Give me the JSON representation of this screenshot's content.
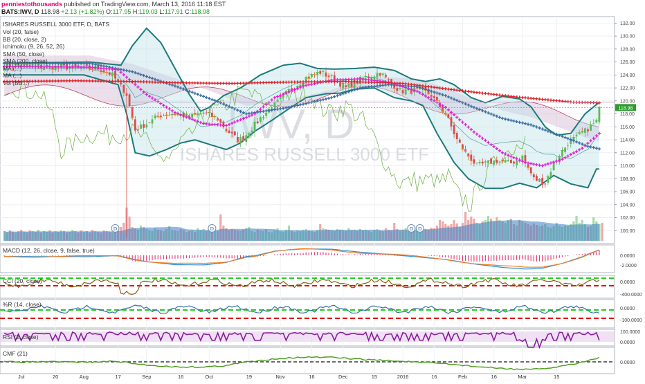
{
  "header": {
    "author": "penniestothousands",
    "published": "published on TradingView.com, March 13, 2016 11:18 EST",
    "symbol": "BATS:IWV, D",
    "last": "118.98",
    "change": "+2.13 (+1.82%)",
    "ohlc_o_label": "O:",
    "ohlc_o": "117.95",
    "ohlc_h_label": "H:",
    "ohlc_h": "119.03",
    "ohlc_l_label": "L:",
    "ohlc_l": "117.91",
    "ohlc_c_label": "C:",
    "ohlc_c": "118.98"
  },
  "main_pane": {
    "title": "ISHARES RUSSELL 3000 ETF, D, BATS",
    "indicators": [
      "Vol (20, false)",
      "BB (20, close, 2)",
      "Ichimoku (9, 26, 52, 26)",
      "SMA (50, close)",
      "SMA (200, close)",
      "MA (...)",
      "MA (...)",
      "Vol (BB...)"
    ],
    "watermark_big": "IWV, D",
    "watermark_small": "ISHARES RUSSELL 3000 ETF",
    "price_badge": "118.98"
  },
  "subpanes": [
    {
      "label": "MACD (12, 26, close, 9, false, true)",
      "ticks": [
        "0.0000",
        "-2.0000"
      ]
    },
    {
      "label": "CCI (20, close)",
      "ticks": [
        "0.0000",
        "-400.0000"
      ]
    },
    {
      "label": "%R (14, close)",
      "ticks": [
        "0.0000",
        "-100.0000"
      ]
    },
    {
      "label": "RSI (2, close)",
      "ticks": [
        "100.0000",
        "0.0000"
      ]
    },
    {
      "label": "CMF (21)",
      "ticks": [
        "0.0000"
      ]
    }
  ],
  "dividend_marker": "D",
  "colors": {
    "up": "#5fb85f",
    "down": "#d94c4c",
    "bb": "#1b7a7a",
    "sma200": "#d9262c",
    "sma50": "#3b6a9e",
    "ma_fast": "#e020d0",
    "ichimoku_cloud": "#c9a2c9",
    "lagging": "#6aad3a",
    "macd": "#2a8fd6",
    "signal": "#ef7d21",
    "hist": "#e0407a",
    "osc": "#2f6f9f",
    "rsi": "#8a1ca0",
    "cmf": "#4a9a1a",
    "level_green": "#22cc22",
    "level_red": "#dd1111"
  },
  "chart_data": {
    "type": "candlestick",
    "title": "ISHARES RUSSELL 3000 ETF, D, BATS",
    "x_tick_labels": [
      "Jul",
      "20",
      "Aug",
      "17",
      "Sep",
      "16",
      "Oct",
      "19",
      "Nov",
      "16",
      "Dec",
      "15",
      "2016",
      "16",
      "Feb",
      "16",
      "Mar",
      "15"
    ],
    "y_tick_labels": [
      "132.00",
      "130.00",
      "128.00",
      "126.00",
      "124.00",
      "122.00",
      "120.00",
      "118.00",
      "116.00",
      "114.00",
      "112.00",
      "110.00",
      "108.00",
      "106.00",
      "104.00",
      "102.00",
      "100.00"
    ],
    "ylim": [
      98,
      133
    ],
    "close_path": [
      [
        0,
        125.5
      ],
      [
        20,
        125.2
      ],
      [
        33,
        125.0
      ],
      [
        38,
        124.0
      ],
      [
        43,
        121.0
      ],
      [
        46,
        115.5
      ],
      [
        50,
        116.5
      ],
      [
        55,
        117.8
      ],
      [
        60,
        118.0
      ],
      [
        65,
        117.5
      ],
      [
        70,
        118.2
      ],
      [
        75,
        117.2
      ],
      [
        78,
        115.5
      ],
      [
        82,
        114.0
      ],
      [
        84,
        114.3
      ],
      [
        89,
        116.8
      ],
      [
        95,
        119.5
      ],
      [
        100,
        121.5
      ],
      [
        106,
        123.5
      ],
      [
        111,
        124.4
      ],
      [
        115,
        123.6
      ],
      [
        120,
        122.0
      ],
      [
        126,
        123.5
      ],
      [
        132,
        124.3
      ],
      [
        134,
        123.5
      ],
      [
        139,
        121.5
      ],
      [
        143,
        121.5
      ],
      [
        147,
        121.7
      ],
      [
        150,
        120.8
      ],
      [
        155,
        118.0
      ],
      [
        159,
        114.0
      ],
      [
        162,
        112.0
      ],
      [
        166,
        110.0
      ],
      [
        173,
        110.8
      ],
      [
        178,
        110.4
      ],
      [
        182,
        111.3
      ],
      [
        186,
        108.0
      ],
      [
        190,
        107.3
      ],
      [
        193,
        110.3
      ],
      [
        198,
        113.5
      ],
      [
        203,
        115.0
      ],
      [
        208,
        116.8
      ],
      [
        209,
        118.98
      ]
    ],
    "bb_upper": [
      [
        0,
        125.8
      ],
      [
        30,
        126.0
      ],
      [
        41,
        125.5
      ],
      [
        45,
        128.5
      ],
      [
        50,
        131.2
      ],
      [
        55,
        129.0
      ],
      [
        60,
        125.0
      ],
      [
        65,
        121.0
      ],
      [
        69,
        118.4
      ],
      [
        72,
        119.0
      ],
      [
        77,
        120.8
      ],
      [
        83,
        122.0
      ],
      [
        90,
        124.0
      ],
      [
        98,
        125.5
      ],
      [
        104,
        125.8
      ],
      [
        110,
        125.0
      ],
      [
        116,
        124.9
      ],
      [
        123,
        125.0
      ],
      [
        130,
        125.2
      ],
      [
        137,
        124.7
      ],
      [
        143,
        123.4
      ],
      [
        148,
        123.0
      ],
      [
        153,
        123.4
      ],
      [
        158,
        122.5
      ],
      [
        164,
        120.5
      ],
      [
        169,
        119.7
      ],
      [
        175,
        120.7
      ],
      [
        181,
        120.3
      ],
      [
        185,
        119.1
      ],
      [
        190,
        116.0
      ],
      [
        194,
        114.7
      ],
      [
        199,
        115.0
      ],
      [
        204,
        118.0
      ],
      [
        209,
        119.8
      ]
    ],
    "bb_lower": [
      [
        0,
        124.0
      ],
      [
        28,
        124.0
      ],
      [
        40,
        122.5
      ],
      [
        43,
        118.0
      ],
      [
        46,
        112.0
      ],
      [
        51,
        111.5
      ],
      [
        57,
        112.5
      ],
      [
        62,
        113.5
      ],
      [
        67,
        114.0
      ],
      [
        72,
        113.3
      ],
      [
        78,
        112.5
      ],
      [
        83,
        113.5
      ],
      [
        88,
        115.3
      ],
      [
        94,
        117.0
      ],
      [
        100,
        118.8
      ],
      [
        106,
        120.5
      ],
      [
        113,
        121.1
      ],
      [
        118,
        121.2
      ],
      [
        123,
        121.8
      ],
      [
        130,
        122.0
      ],
      [
        137,
        120.5
      ],
      [
        143,
        120.0
      ],
      [
        147,
        119.3
      ],
      [
        152,
        115.0
      ],
      [
        158,
        110.5
      ],
      [
        163,
        108.0
      ],
      [
        169,
        106.5
      ],
      [
        175,
        106.5
      ],
      [
        181,
        107.3
      ],
      [
        187,
        106.6
      ],
      [
        193,
        108.5
      ],
      [
        199,
        107.2
      ],
      [
        205,
        106.6
      ],
      [
        208,
        109.5
      ]
    ],
    "sma200": [
      [
        0,
        123.0
      ],
      [
        25,
        123.1
      ],
      [
        45,
        123.0
      ],
      [
        60,
        122.8
      ],
      [
        80,
        122.7
      ],
      [
        100,
        122.9
      ],
      [
        120,
        123.0
      ],
      [
        140,
        122.7
      ],
      [
        160,
        121.6
      ],
      [
        180,
        120.6
      ],
      [
        200,
        119.8
      ],
      [
        209,
        119.7
      ]
    ],
    "sma50": [
      [
        0,
        125.8
      ],
      [
        30,
        125.8
      ],
      [
        45,
        124.5
      ],
      [
        60,
        122.3
      ],
      [
        75,
        119.9
      ],
      [
        85,
        118.0
      ],
      [
        100,
        119.0
      ],
      [
        115,
        120.5
      ],
      [
        125,
        122.0
      ],
      [
        135,
        122.5
      ],
      [
        145,
        122.2
      ],
      [
        155,
        120.8
      ],
      [
        165,
        119.0
      ],
      [
        175,
        117.3
      ],
      [
        185,
        116.3
      ],
      [
        195,
        114.7
      ],
      [
        205,
        113.0
      ],
      [
        209,
        112.6
      ]
    ],
    "ma_fast": [
      [
        0,
        125.3
      ],
      [
        30,
        125.2
      ],
      [
        40,
        124.8
      ],
      [
        50,
        121.0
      ],
      [
        60,
        118.2
      ],
      [
        70,
        116.5
      ],
      [
        78,
        116.2
      ],
      [
        88,
        118.0
      ],
      [
        95,
        120.5
      ],
      [
        105,
        122.3
      ],
      [
        115,
        123.2
      ],
      [
        125,
        123.4
      ],
      [
        135,
        122.9
      ],
      [
        145,
        121.5
      ],
      [
        155,
        119.0
      ],
      [
        165,
        115.2
      ],
      [
        175,
        112.0
      ],
      [
        183,
        110.5
      ],
      [
        189,
        110.0
      ],
      [
        196,
        111.0
      ],
      [
        203,
        112.7
      ],
      [
        209,
        115.0
      ]
    ],
    "volume": [
      14,
      12,
      15,
      13,
      12,
      14,
      16,
      13,
      12,
      15,
      14,
      13,
      16,
      12,
      14,
      13,
      15,
      12,
      14,
      13,
      15,
      14,
      12,
      13,
      16,
      14,
      12,
      15,
      13,
      14,
      12,
      16,
      14,
      13,
      12,
      15,
      14,
      13,
      12,
      16,
      18,
      20,
      26,
      48,
      35,
      20,
      18,
      16,
      22,
      20,
      17,
      15,
      14,
      18,
      16,
      15,
      14,
      17,
      21,
      16,
      15,
      14,
      17,
      16,
      13,
      14,
      15,
      13,
      18,
      16,
      17,
      14,
      22,
      15,
      16,
      14,
      38,
      22,
      18,
      15,
      17,
      16,
      15,
      14,
      16,
      18,
      20,
      14,
      13,
      16,
      15,
      14,
      17,
      13,
      12,
      15,
      18,
      14,
      13,
      16,
      22,
      14,
      13,
      15,
      14,
      16,
      17,
      15,
      14,
      13,
      16,
      24,
      18,
      17,
      16,
      15,
      14,
      17,
      16,
      15,
      14,
      18,
      15,
      16,
      14,
      17,
      15,
      16,
      14,
      13,
      16,
      17,
      15,
      14,
      18,
      16,
      15,
      26,
      17,
      15,
      16,
      18,
      14,
      15,
      17,
      16,
      20,
      18,
      17,
      16,
      19,
      18,
      22,
      30,
      28,
      24,
      22,
      24,
      30,
      25,
      20,
      26,
      42,
      30,
      35,
      32,
      26,
      24,
      28,
      30,
      36,
      32,
      28,
      34,
      30,
      28,
      26,
      30,
      32,
      24,
      22,
      30,
      28,
      26,
      24,
      22,
      25,
      23,
      21,
      22,
      24,
      20,
      19,
      21,
      26,
      22,
      20,
      22,
      21,
      24,
      28,
      36,
      26,
      30,
      24,
      20,
      22,
      34,
      28,
      24,
      26
    ],
    "volume_range": [
      0,
      60
    ]
  }
}
